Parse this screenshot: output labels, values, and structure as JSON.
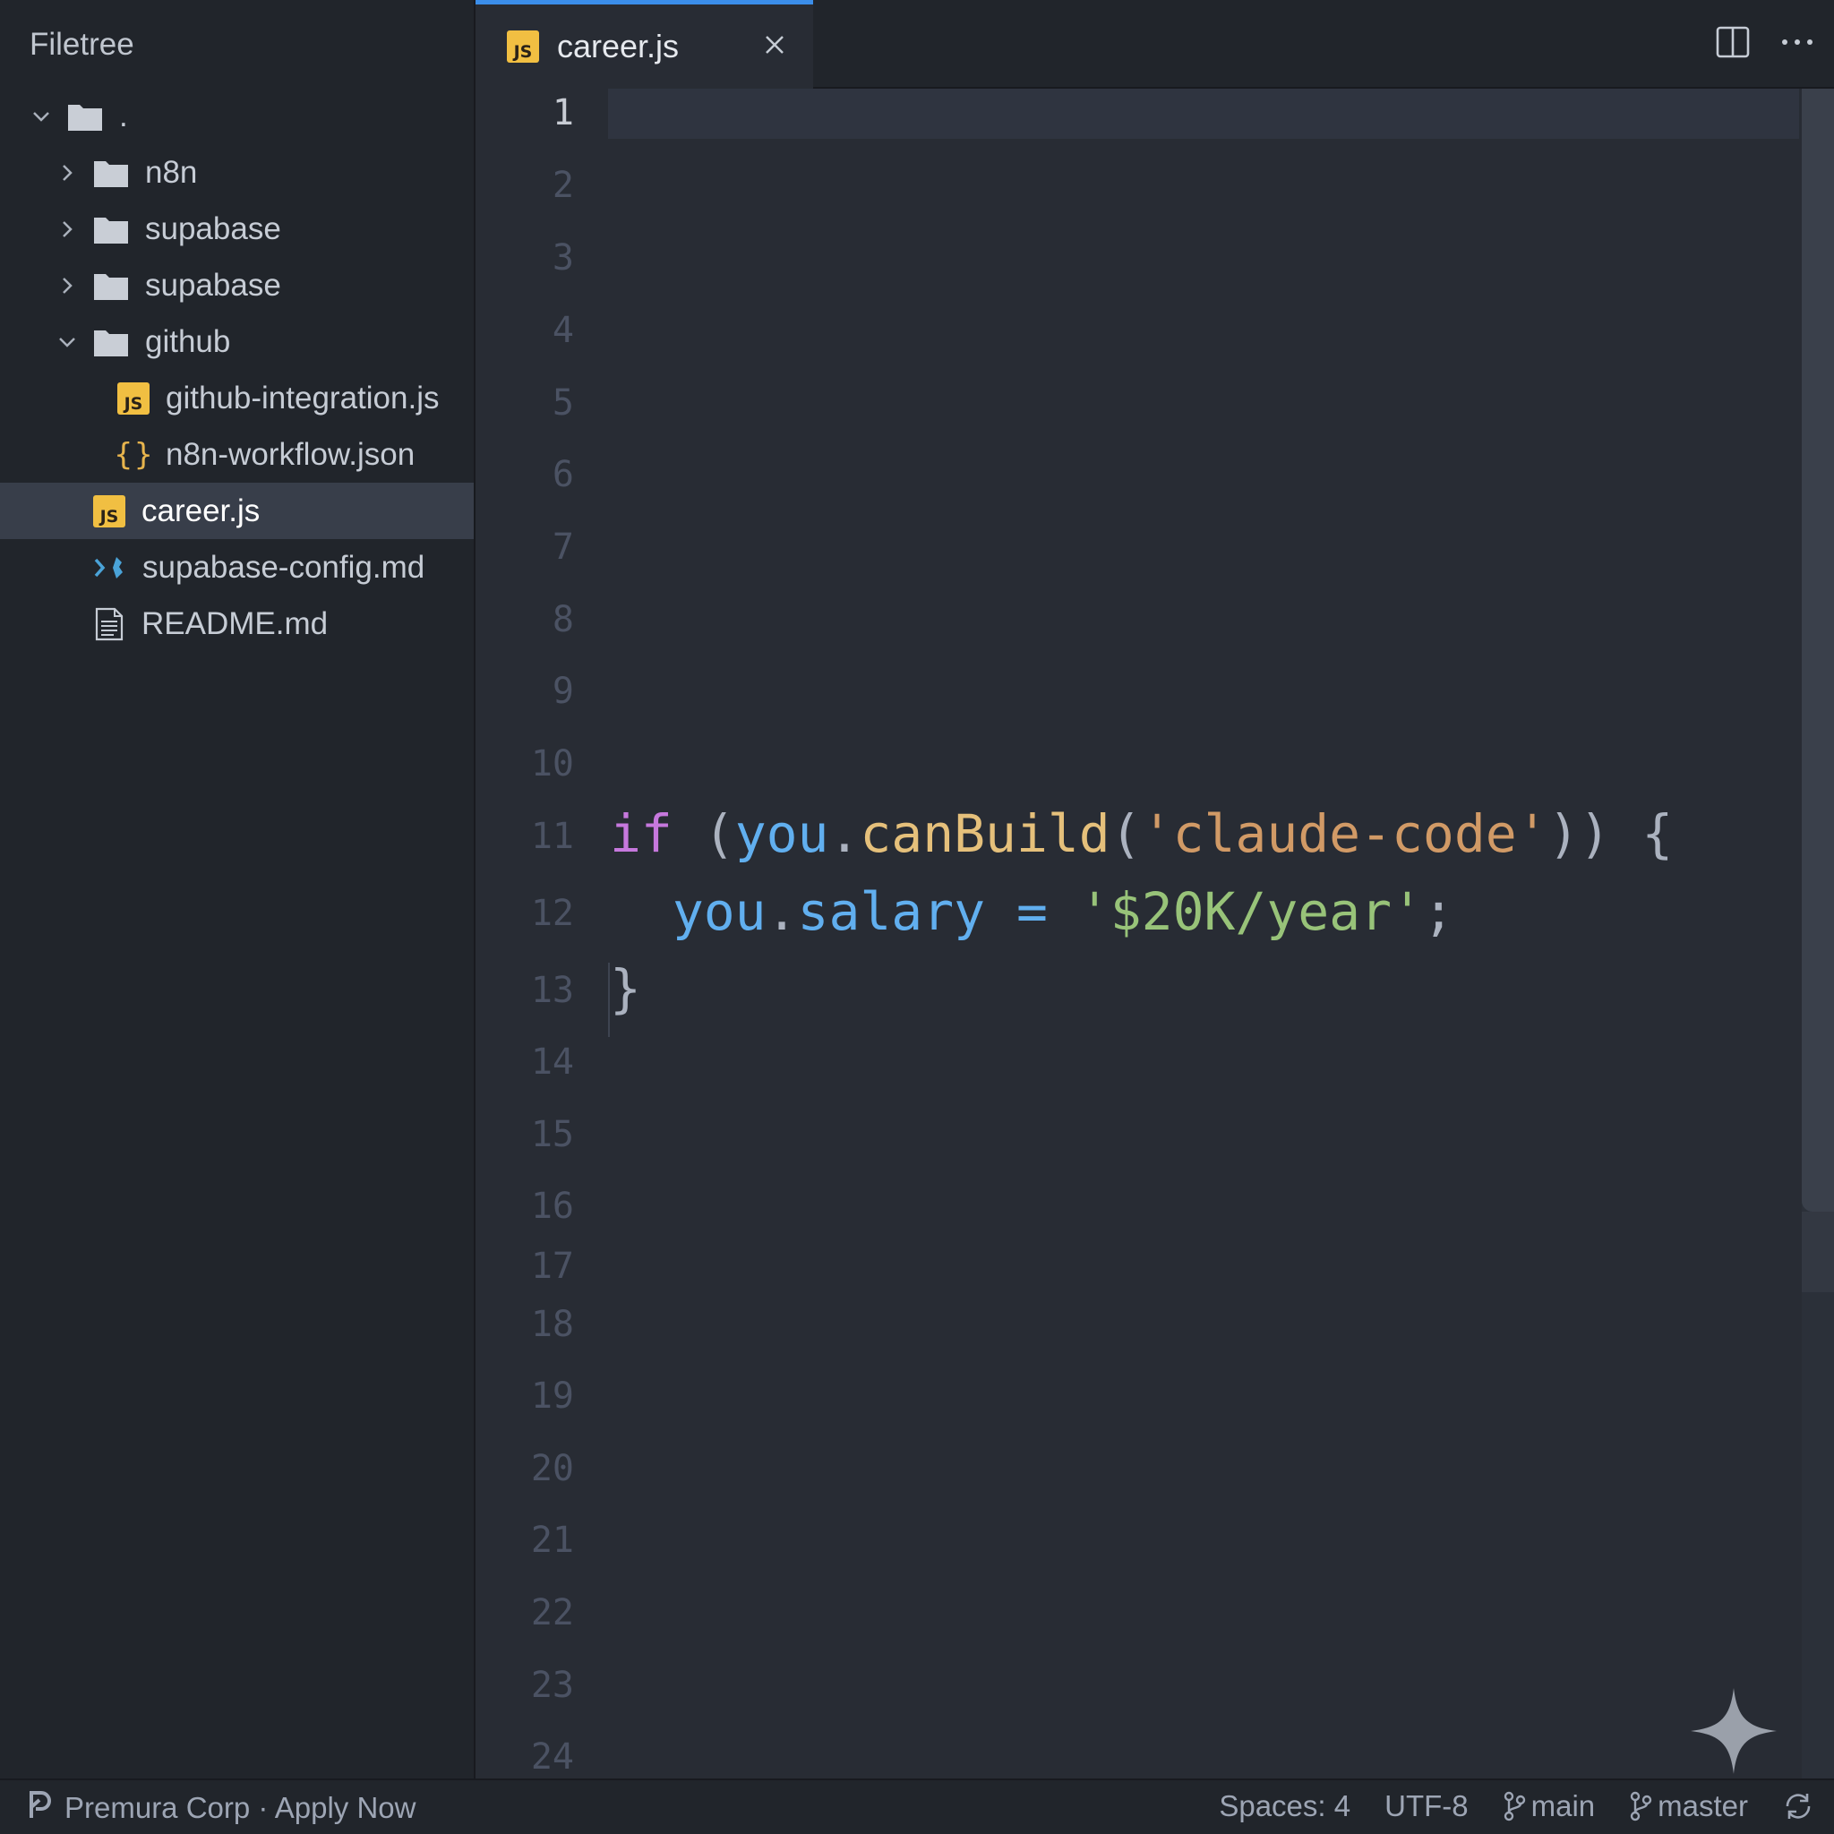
{
  "sidebar": {
    "title": "Filetree",
    "items": [
      {
        "label": ".",
        "kind": "folder",
        "expanded": true
      },
      {
        "label": "n8n",
        "kind": "folder",
        "expanded": false
      },
      {
        "label": "supabase",
        "kind": "folder",
        "expanded": false
      },
      {
        "label": "supabase",
        "kind": "folder",
        "expanded": false
      },
      {
        "label": "github",
        "kind": "folder",
        "expanded": true
      },
      {
        "label": "github-integration.js",
        "kind": "js"
      },
      {
        "label": "n8n-workflow.json",
        "kind": "json"
      },
      {
        "label": "career.js",
        "kind": "js",
        "selected": true
      },
      {
        "label": "supabase-config.md",
        "kind": "markdown"
      },
      {
        "label": "README.md",
        "kind": "text"
      }
    ]
  },
  "tabs": [
    {
      "label": "career.js",
      "icon": "js-file-icon",
      "active": true
    }
  ],
  "editor": {
    "line_numbers": [
      "1",
      "2",
      "3",
      "4",
      "5",
      "6",
      "7",
      "8",
      "9",
      "10",
      "11",
      "12",
      "13",
      "14",
      "15",
      "16",
      "17",
      "18",
      "19",
      "20",
      "21",
      "22",
      "23",
      "24"
    ],
    "active_line": "1",
    "code": {
      "line11": {
        "kw": "if",
        "open": " (",
        "obj": "you",
        "dot": ".",
        "method": "canBuild",
        "paren": "(",
        "arg": "'claude-code'",
        "close": ")) {"
      },
      "line12": {
        "indent": "  ",
        "obj": "you",
        "dot": ".",
        "prop": "salary",
        "eq": " = ",
        "value": "'$20K/year'",
        "semi": ";"
      },
      "line13": {
        "close": "}"
      }
    }
  },
  "statusbar": {
    "left": "Premura Corp · Apply Now",
    "spaces": "Spaces: 4",
    "encoding": "UTF-8",
    "branch1": "main",
    "branch2": "master"
  },
  "colors": {
    "keyword": "#c678dd",
    "variable": "#61afef",
    "function": "#e5c07b",
    "string_arg": "#d19a66",
    "string_value": "#98c379",
    "tab_accent": "#3b8eea",
    "js_badge": "#f1bf42"
  }
}
